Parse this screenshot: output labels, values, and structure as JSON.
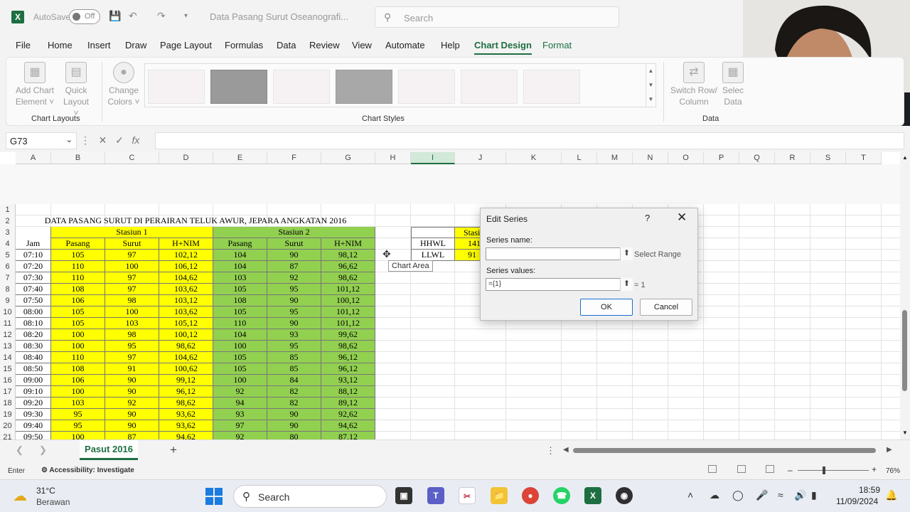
{
  "titlebar": {
    "autosave_label": "AutoSave",
    "autosave_state": "Off",
    "doc_title": "Data Pasang Surut Oseanografi...",
    "search_placeholder": "Search"
  },
  "menu": [
    "File",
    "Home",
    "Insert",
    "Draw",
    "Page Layout",
    "Formulas",
    "Data",
    "Review",
    "View",
    "Automate",
    "Help",
    "Chart Design",
    "Format"
  ],
  "active_menu": "Chart Design",
  "ribbon": {
    "add_chart_element": [
      "Add Chart",
      "Element"
    ],
    "quick_layout": [
      "Quick",
      "Layout"
    ],
    "change_colors": [
      "Change",
      "Colors"
    ],
    "switch_row_column": [
      "Switch Row/",
      "Column"
    ],
    "select_data": [
      "Selec",
      "Data"
    ],
    "group_chart_layouts": "Chart Layouts",
    "group_chart_styles": "Chart Styles",
    "group_data": "Data"
  },
  "formula_bar": {
    "name_box": "G73",
    "fx": "fx",
    "formula": ""
  },
  "columns": [
    "A",
    "B",
    "C",
    "D",
    "E",
    "F",
    "G",
    "H",
    "I",
    "J",
    "K",
    "L",
    "M",
    "N",
    "O",
    "P",
    "Q",
    "R",
    "S",
    "T"
  ],
  "row_numbers": [
    "1",
    "2",
    "3",
    "4",
    "5",
    "6",
    "7",
    "8",
    "9",
    "10",
    "11",
    "12",
    "13",
    "14",
    "15",
    "16",
    "17",
    "18",
    "19",
    "20",
    "21"
  ],
  "sheet": {
    "title": "DATA PASANG SURUT DI PERAIRAN TELUK AWUR, JEPARA ANGKATAN 2016",
    "station1": "Stasiun 1",
    "station2": "Stasiun 2",
    "headers": [
      "Jam",
      "Pasang",
      "Surut",
      "H+NIM",
      "Pasang",
      "Surut",
      "H+NIM"
    ],
    "rows": [
      [
        "07:10",
        "105",
        "97",
        "102,12",
        "104",
        "90",
        "98,12"
      ],
      [
        "07:20",
        "110",
        "100",
        "106,12",
        "104",
        "87",
        "96,62"
      ],
      [
        "07:30",
        "110",
        "97",
        "104,62",
        "103",
        "92",
        "98,62"
      ],
      [
        "07:40",
        "108",
        "97",
        "103,62",
        "105",
        "95",
        "101,12"
      ],
      [
        "07:50",
        "106",
        "98",
        "103,12",
        "108",
        "90",
        "100,12"
      ],
      [
        "08:00",
        "105",
        "100",
        "103,62",
        "105",
        "95",
        "101,12"
      ],
      [
        "08:10",
        "105",
        "103",
        "105,12",
        "110",
        "90",
        "101,12"
      ],
      [
        "08:20",
        "100",
        "98",
        "100,12",
        "104",
        "93",
        "99,62"
      ],
      [
        "08:30",
        "100",
        "95",
        "98,62",
        "100",
        "95",
        "98,62"
      ],
      [
        "08:40",
        "110",
        "97",
        "104,62",
        "105",
        "85",
        "96,12"
      ],
      [
        "08:50",
        "108",
        "91",
        "100,62",
        "105",
        "85",
        "96,12"
      ],
      [
        "09:00",
        "106",
        "90",
        "99,12",
        "100",
        "84",
        "93,12"
      ],
      [
        "09:10",
        "100",
        "90",
        "96,12",
        "92",
        "82",
        "88,12"
      ],
      [
        "09:20",
        "103",
        "92",
        "98,62",
        "94",
        "82",
        "89,12"
      ],
      [
        "09:30",
        "95",
        "90",
        "93,62",
        "93",
        "90",
        "92,62"
      ],
      [
        "09:40",
        "95",
        "90",
        "93,62",
        "97",
        "90",
        "94,62"
      ],
      [
        "09:50",
        "100",
        "87",
        "94,62",
        "92",
        "80",
        "87,12"
      ]
    ],
    "side_table": {
      "header_partial": "Stasi",
      "labels": [
        "HHWL",
        "LLWL"
      ],
      "values": [
        "141",
        "91"
      ]
    }
  },
  "tooltip": "Chart Area",
  "dialog": {
    "title": "Edit Series",
    "help": "?",
    "close": "✕",
    "series_name_label": "Series name:",
    "series_name_value": "",
    "select_range": "Select Range",
    "series_values_label": "Series values:",
    "series_values_value": "={1}",
    "series_values_result": "= 1",
    "ok": "OK",
    "cancel": "Cancel"
  },
  "sheet_tab": "Pasut 2016",
  "status": {
    "mode": "Enter",
    "accessibility": "Accessibility: Investigate",
    "zoom": "76%"
  },
  "taskbar": {
    "temperature": "31°C",
    "weather": "Berawan",
    "search_placeholder": "Search",
    "time": "18:59",
    "date": "11/09/2024"
  },
  "colors": {
    "excel_green": "#1d6f42",
    "yellow_fill": "#ffff00",
    "green_fill": "#92d050",
    "ok_border": "#1a6fd1"
  },
  "icons": [
    "excel-icon",
    "save-icon",
    "undo-icon",
    "redo-icon",
    "search-icon",
    "weather-cloud-icon",
    "windows-icon",
    "teams-icon",
    "chrome-icon",
    "whatsapp-icon",
    "obs-icon",
    "file-explorer-icon",
    "wifi-icon",
    "volume-icon",
    "battery-icon",
    "bell-icon"
  ]
}
